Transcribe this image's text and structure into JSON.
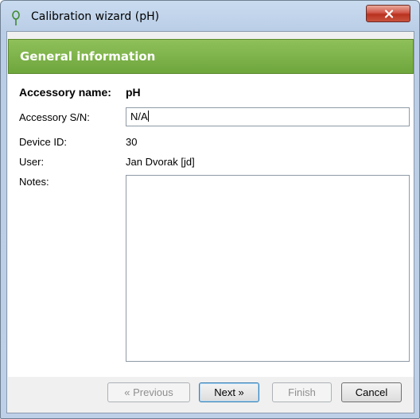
{
  "window": {
    "title": "Calibration wizard (pH)"
  },
  "banner": {
    "title": "General information"
  },
  "form": {
    "accessory_name_label": "Accessory name:",
    "accessory_name_value": "pH",
    "serial_label": "Accessory S/N:",
    "serial_value": "N/A",
    "device_id_label": "Device ID:",
    "device_id_value": "30",
    "user_label": "User:",
    "user_value": "Jan Dvorak [jd]",
    "notes_label": "Notes:",
    "notes_value": ""
  },
  "buttons": {
    "previous": "« Previous",
    "next": "Next »",
    "finish": "Finish",
    "cancel": "Cancel"
  },
  "icons": {
    "app": "ph-probe-icon",
    "close": "close-icon"
  },
  "colors": {
    "banner": "#78b043",
    "close_button": "#c9463a"
  }
}
